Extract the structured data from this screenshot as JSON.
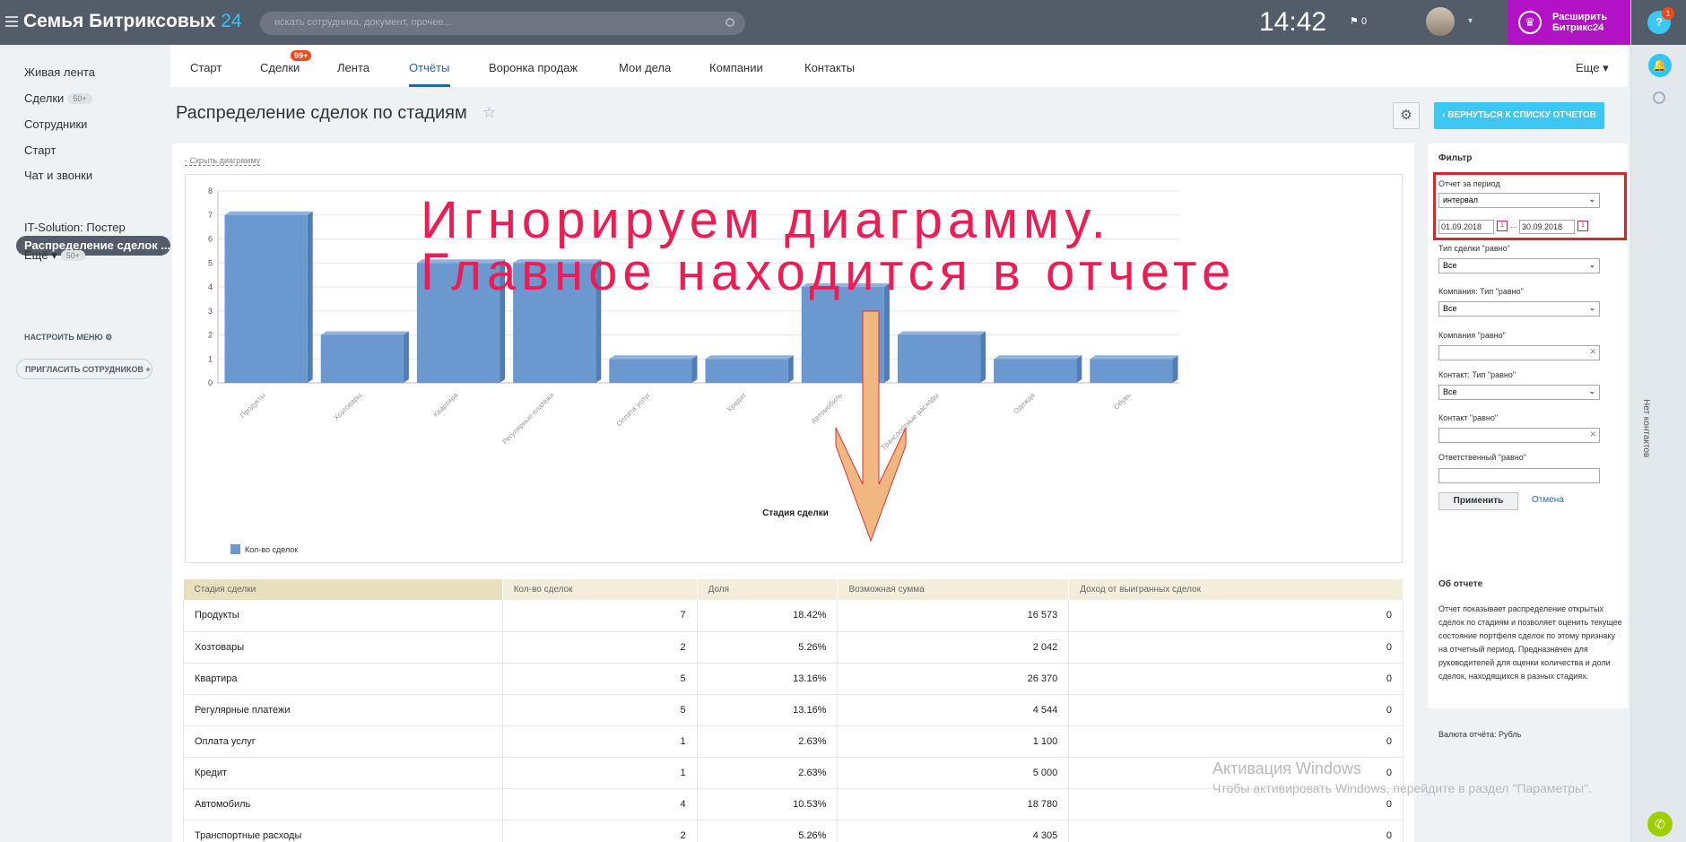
{
  "topbar": {
    "brand": "Семья Битриксовых",
    "brand_suffix": "24",
    "search_placeholder": "искать сотрудника, документ, прочее...",
    "time": "14:42",
    "flag_count": "0",
    "upgrade_line1": "Расширить",
    "upgrade_line2": "Битрикс24",
    "help_label": "?",
    "help_badge": "1"
  },
  "leftmenu": {
    "items": [
      {
        "label": "Живая лента"
      },
      {
        "label": "Сделки",
        "badge": "50+"
      },
      {
        "label": "Сотрудники"
      },
      {
        "label": "Старт"
      },
      {
        "label": "Чат и звонки"
      },
      {
        "label": "Распределение сделок ..."
      },
      {
        "label": "IT-Solution: Постер"
      },
      {
        "label": "Ещё ▾",
        "badge": "50+"
      }
    ],
    "setup_menu": "НАСТРОИТЬ МЕНЮ",
    "invite": "ПРИГЛАСИТЬ СОТРУДНИКОВ"
  },
  "tabs": {
    "items": [
      "Старт",
      "Сделки",
      "Лента",
      "Отчёты",
      "Воронка продаж",
      "Мои дела",
      "Компании",
      "Контакты"
    ],
    "deals_badge": "99+",
    "more": "Еще ▾"
  },
  "page": {
    "title": "Распределение сделок по стадиям",
    "back_button": "ВЕРНУТЬСЯ К СПИСКУ ОТЧЕТОВ",
    "hide_chart": "Скрыть диаграмму"
  },
  "annotation": {
    "line1": "Игнорируем диаграмму.",
    "line2": "Главное находится в отчете"
  },
  "chart_data": {
    "type": "bar",
    "categories": [
      "Продукты",
      "Хозтовары",
      "Квартира",
      "Регулярные платежи",
      "Оплата услуг",
      "Кредит",
      "Автомобиль",
      "Транспортные расходы",
      "Одежда",
      "Обувь"
    ],
    "values": [
      7,
      2,
      5,
      5,
      1,
      1,
      4,
      2,
      1,
      1
    ],
    "xlabel": "Стадия сделки",
    "ylabel": "",
    "ylim": [
      0,
      8
    ],
    "yticks": [
      "0",
      "1",
      "2",
      "3",
      "4",
      "5",
      "6",
      "7",
      "8"
    ],
    "legend": "Кол-во сделок",
    "bar_color": "#6b99cf"
  },
  "table": {
    "headers": [
      "Стадия сделки",
      "Кол-во сделок",
      "Доля",
      "Возможная сумма",
      "Доход от выигранных сделок"
    ],
    "rows": [
      [
        "Продукты",
        "7",
        "18.42%",
        "16 573",
        "0"
      ],
      [
        "Хозтовары",
        "2",
        "5.26%",
        "2 042",
        "0"
      ],
      [
        "Квартира",
        "5",
        "13.16%",
        "26 370",
        "0"
      ],
      [
        "Регулярные платежи",
        "5",
        "13.16%",
        "4 544",
        "0"
      ],
      [
        "Оплата услуг",
        "1",
        "2.63%",
        "1 100",
        "0"
      ],
      [
        "Кредит",
        "1",
        "2.63%",
        "5 000",
        "0"
      ],
      [
        "Автомобиль",
        "4",
        "10.53%",
        "18 780",
        "0"
      ],
      [
        "Транспортные расходы",
        "2",
        "5.26%",
        "4 305",
        "0"
      ]
    ]
  },
  "filter": {
    "title": "Фильтр",
    "period_label": "Отчет за период",
    "period_value": "интервал",
    "date_from": "01.09.2018",
    "date_sep": "...",
    "date_to": "30.09.2018",
    "deal_type_label": "Тип сделки \"равно\"",
    "deal_type_value": "Все",
    "company_type_label": "Компания: Тип \"равно\"",
    "company_type_value": "Все",
    "company_label": "Компания \"равно\"",
    "contact_type_label": "Контакт: Тип \"равно\"",
    "contact_type_value": "Все",
    "contact_label": "Контакт \"равно\"",
    "responsible_label": "Ответственный \"равно\"",
    "apply": "Применить",
    "cancel": "Отмена",
    "about_title": "Об отчете",
    "about_text": "Отчет показывает распределение открытых сделок по стадиям и позволяет оценить текущее состояние портфеля сделок по этому признаку на отчетный период. Предназначен для руководителей для оценки количества и доли сделок, находящихся в разных стадиях.",
    "currency": "Валюта отчёта: Рубль"
  },
  "rightstrip": {
    "contacts": "Нет контактов"
  },
  "watermark": {
    "line1": "Активация Windows",
    "line2": "Чтобы активировать Windows, перейдите в раздел \"Параметры\"."
  }
}
